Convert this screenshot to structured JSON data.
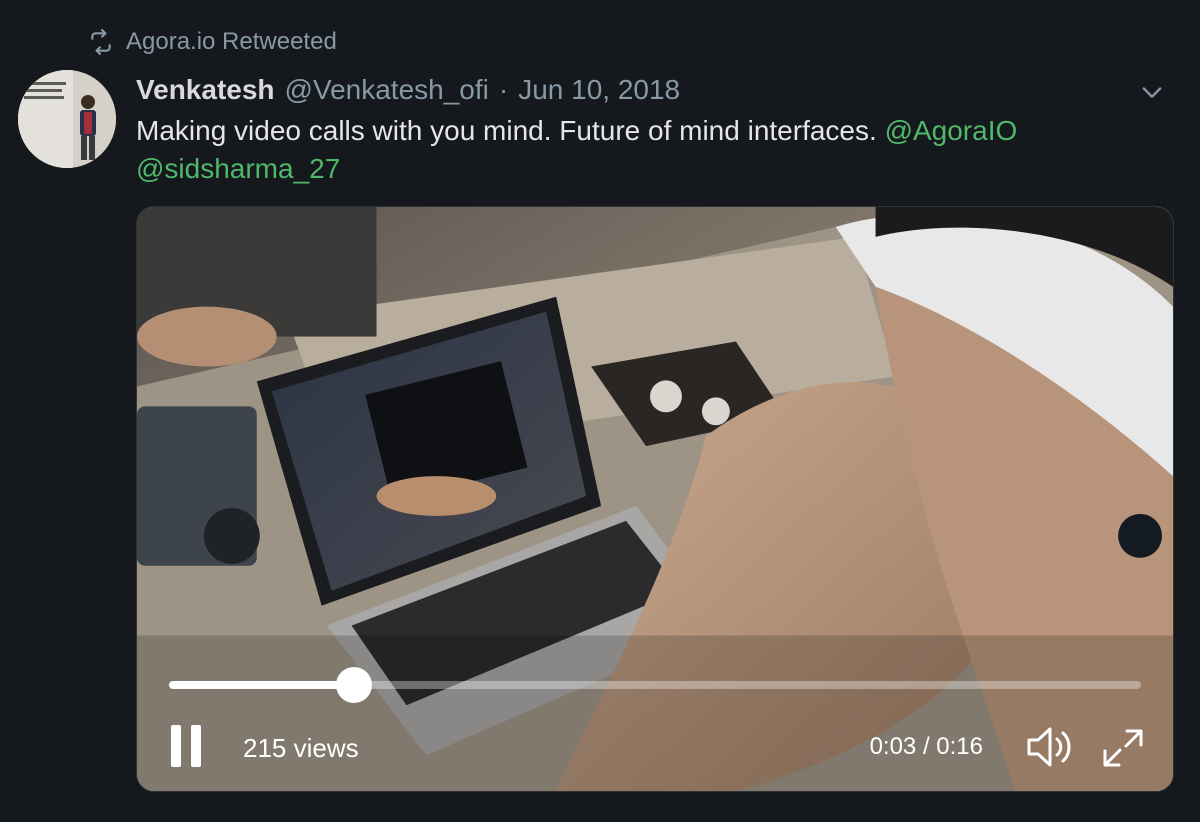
{
  "retweet": {
    "icon": "retweet-icon",
    "label": "Agora.io Retweeted"
  },
  "author": {
    "display_name": "Venkatesh",
    "handle": "@Venkatesh_ofi",
    "separator": "·",
    "date": "Jun 10, 2018"
  },
  "tweet": {
    "text": "Making video calls with you mind. Future of mind interfaces. ",
    "mentions": [
      "@AgoraIO",
      "@sidsharma_27"
    ]
  },
  "video": {
    "views": "215 views",
    "time": "0:03 / 0:16",
    "progress_fraction": 0.19,
    "pause_icon": "pause-icon",
    "volume_icon": "volume-icon",
    "expand_icon": "expand-icon"
  },
  "colors": {
    "background": "#15181c",
    "mention": "#4fb86a",
    "secondary_text": "#8899a6"
  }
}
